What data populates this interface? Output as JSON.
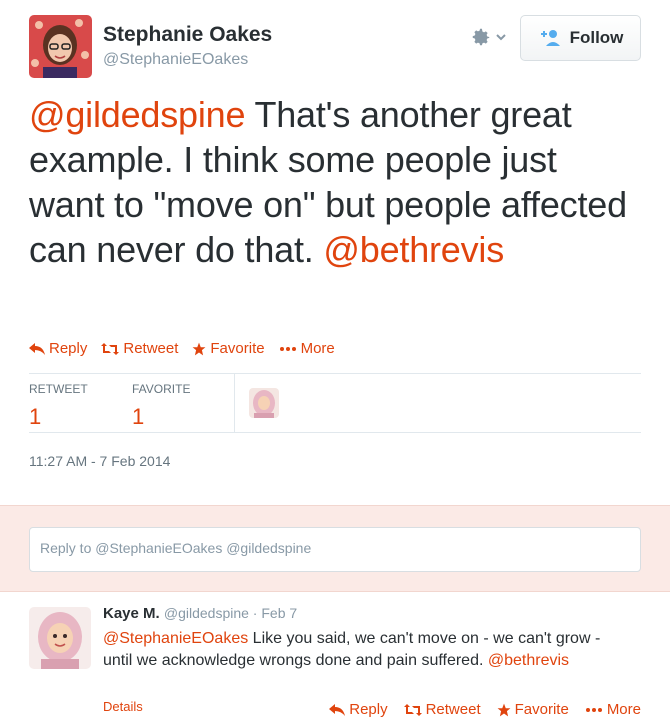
{
  "tweet": {
    "author_name": "Stephanie Oakes",
    "author_handle": "@StephanieEOakes",
    "follow_label": "Follow",
    "text": {
      "mention1": "@gildedspine",
      "body": " That's another great example. I think some people just want to \"move on\" but people affected can never do that. ",
      "mention2": "@bethrevis"
    },
    "actions": {
      "reply": "Reply",
      "retweet": "Retweet",
      "favorite": "Favorite",
      "more": "More"
    },
    "stats": {
      "retweet_label": "RETWEET",
      "retweet_count": "1",
      "favorite_label": "FAVORITE",
      "favorite_count": "1"
    },
    "timestamp": "11:27 AM - 7 Feb 2014"
  },
  "reply_box": {
    "text": "Reply to @StephanieEOakes @gildedspine"
  },
  "reply_tweet": {
    "author_name": "Kaye M.",
    "author_handle": "@gildedspine",
    "separator": " · ",
    "date": "Feb 7",
    "mention1": "@StephanieEOakes",
    "body": " Like you said, we can't move on - we can't grow - until we acknowledge wrongs done and pain suffered. ",
    "mention2": "@bethrevis",
    "details": "Details",
    "actions": {
      "reply": "Reply",
      "retweet": "Retweet",
      "favorite": "Favorite",
      "more": "More"
    }
  },
  "colors": {
    "accent": "#e0440e",
    "text": "#292f33",
    "muted": "#8899a6",
    "reply_bg": "#fbeae6"
  },
  "icons": [
    "gear-icon",
    "chevron-down-icon",
    "add-user-icon",
    "reply-icon",
    "retweet-icon",
    "star-icon",
    "more-dots-icon"
  ]
}
